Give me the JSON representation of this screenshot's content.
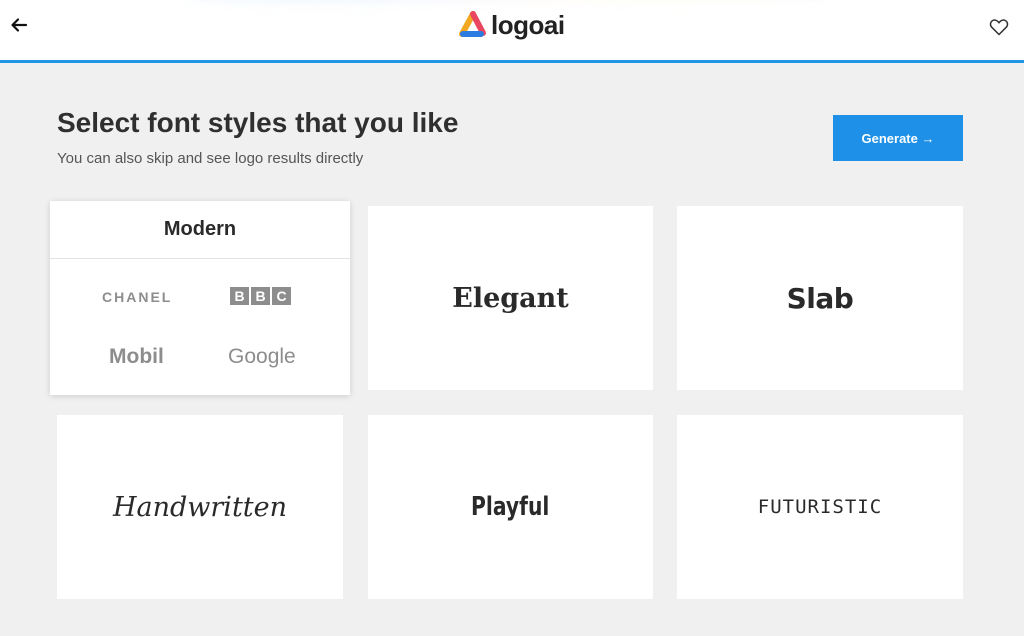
{
  "header": {
    "brand_name": "logoai",
    "back_icon": "arrow-left-icon",
    "favorite_icon": "heart-icon",
    "accent_color": "#2196e8"
  },
  "main": {
    "title": "Select font styles that you like",
    "subtitle": "You can also skip and see logo results directly",
    "generate_label": "Generate →"
  },
  "styles": {
    "modern": {
      "label": "Modern",
      "selected": true,
      "samples": {
        "chanel": "CHANEL",
        "bbc": [
          "B",
          "B",
          "C"
        ],
        "mobil": "Mobil",
        "google": "Google"
      }
    },
    "elegant": {
      "label": "Elegant"
    },
    "slab": {
      "label": "Slab"
    },
    "handwritten": {
      "label": "Handwritten"
    },
    "playful": {
      "label": "Playful"
    },
    "futuristic": {
      "label": "FUTURISTIC"
    }
  }
}
